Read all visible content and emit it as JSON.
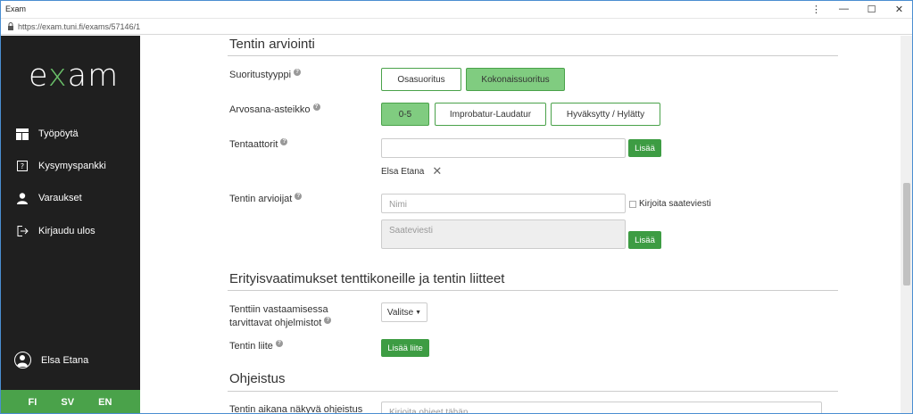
{
  "window": {
    "title": "Exam",
    "controls": [
      "⋮",
      "—",
      "☐",
      "✕"
    ]
  },
  "address": {
    "url": "https://exam.tuni.fi/exams/57146/1"
  },
  "sidebar": {
    "logo_prefix": "e",
    "logo_x": "x",
    "logo_suffix": "am",
    "items": [
      {
        "label": "Työpöytä",
        "icon": "dashboard-icon"
      },
      {
        "label": "Kysymyspankki",
        "icon": "question-bank-icon"
      },
      {
        "label": "Varaukset",
        "icon": "user-icon"
      },
      {
        "label": "Kirjaudu ulos",
        "icon": "logout-icon"
      }
    ],
    "user_name": "Elsa Etana",
    "languages": [
      "FI",
      "SV",
      "EN"
    ]
  },
  "grading": {
    "title": "Tentin arviointi",
    "type_label": "Suoritustyyppi",
    "type_options": [
      "Osasuoritus",
      "Kokonaissuoritus"
    ],
    "type_selected": "Kokonaissuoritus",
    "scale_label": "Arvosana-asteikko",
    "scale_options": [
      "0-5",
      "Improbatur-Laudatur",
      "Hyväksytty / Hylätty"
    ],
    "scale_selected": "0-5",
    "examiners_label": "Tentaattorit",
    "examiners_input_value": "",
    "add_label": "Lisää",
    "examiner_chip": "Elsa Etana",
    "graders_label": "Tentin arvioijat",
    "graders_placeholder": "Nimi",
    "message_checkbox_label": "Kirjoita saateviesti",
    "message_placeholder": "Saateviesti",
    "add_label_2": "Lisää"
  },
  "requirements": {
    "title": "Erityisvaatimukset tenttikoneille ja tentin liitteet",
    "software_label_line1": "Tenttiin vastaamisessa",
    "software_label_line2": "tarvittavat ohjelmistot",
    "software_dropdown": "Valitse",
    "attachment_label": "Tentin liite",
    "attachment_button": "Lisää liite"
  },
  "instructions": {
    "title": "Ohjeistus",
    "visible_label": "Tentin aikana näkyvä ohjeistus",
    "visible_placeholder": "Kirjoita ohjeet tähän"
  }
}
